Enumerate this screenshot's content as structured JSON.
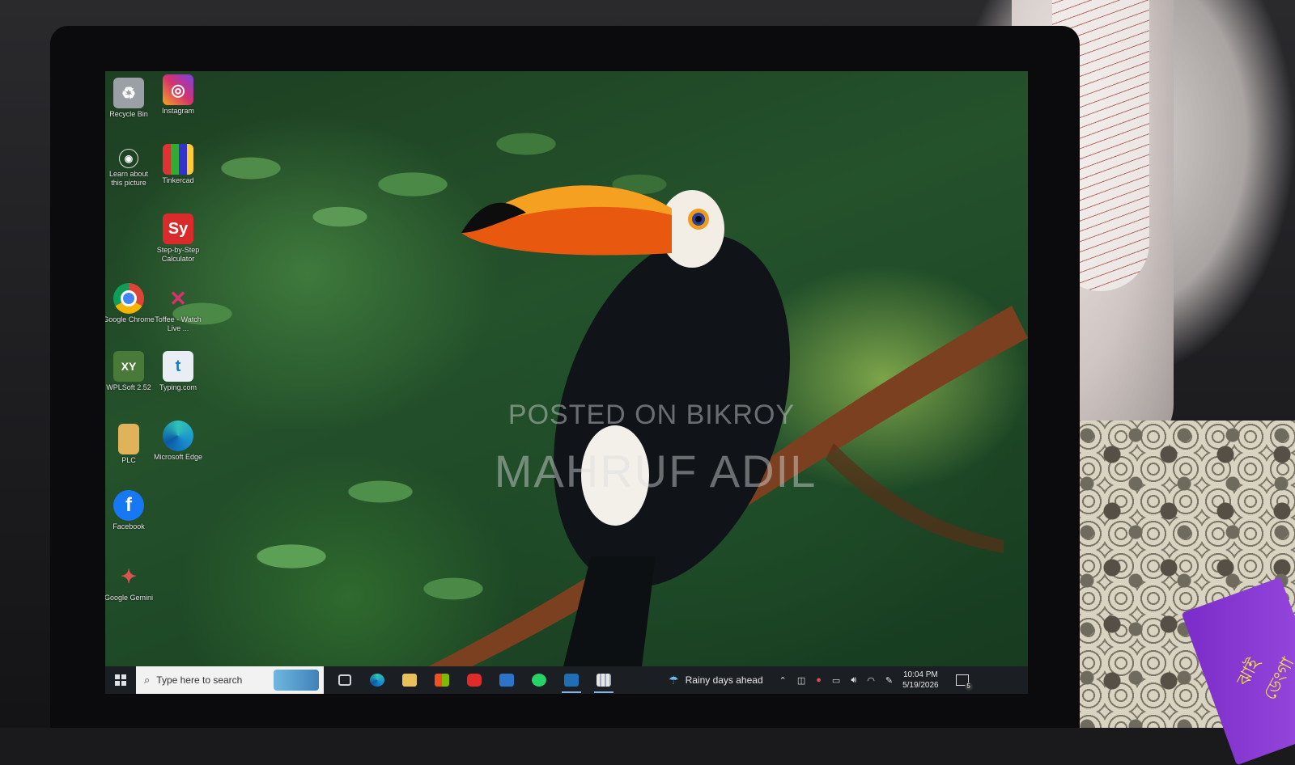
{
  "desktop_icons": [
    {
      "name": "recycle-bin",
      "label": "Recycle Bin",
      "icon": "recycle-bin-icon",
      "color": "#9aa0a6"
    },
    {
      "name": "instagram",
      "label": "Instagram",
      "icon": "instagram-icon",
      "color": "#d6336c"
    },
    {
      "name": "learn-about-picture",
      "label": "Learn about this picture",
      "icon": "camera-icon",
      "color": "#3b3b3b"
    },
    {
      "name": "tinkercad",
      "label": "Tinkercad",
      "icon": "tinkercad-icon",
      "color": "#e8e8e8"
    },
    {
      "name": "step-by-step-calculator",
      "label": "Step-by-Step Calculator",
      "icon": "calculator-icon",
      "glyph": "Sy",
      "color": "#d92b2b"
    },
    {
      "name": "google-chrome",
      "label": "Google Chrome",
      "icon": "chrome-icon",
      "color": "#1f8f3a"
    },
    {
      "name": "toffee",
      "label": "Toffee - Watch Live ...",
      "icon": "toffee-icon",
      "color": "#c0306a"
    },
    {
      "name": "wplsoft",
      "label": "WPLSoft 2.52",
      "icon": "wplsoft-icon",
      "glyph": "XY",
      "color": "#4a7a3a"
    },
    {
      "name": "typing-com",
      "label": "Typing.com",
      "icon": "typing-icon",
      "glyph": "t",
      "color": "#e8eef4"
    },
    {
      "name": "plc",
      "label": "PLC",
      "icon": "folder-icon",
      "color": "#e0b25a"
    },
    {
      "name": "microsoft-edge",
      "label": "Microsoft Edge",
      "icon": "edge-icon",
      "color": "#1a8fcf"
    },
    {
      "name": "facebook",
      "label": "Facebook",
      "icon": "facebook-icon",
      "glyph": "f",
      "color": "#1877f2"
    },
    {
      "name": "google-gemini",
      "label": "Google Gemini",
      "icon": "gemini-icon",
      "color": "#d9534f"
    }
  ],
  "watermark": {
    "line1": "POSTED ON BIKROY",
    "line2": "MAHRUF ADIL"
  },
  "taskbar": {
    "search_placeholder": "Type here to search",
    "apps": [
      {
        "name": "task-view",
        "icon": "task-view-icon",
        "color": "#cfd3d8"
      },
      {
        "name": "edge",
        "icon": "edge-icon",
        "color": "#1a8fcf"
      },
      {
        "name": "file-explorer",
        "icon": "folder-icon",
        "color": "#e8c15a"
      },
      {
        "name": "microsoft-store",
        "icon": "store-icon",
        "color": "#f0f0f0"
      },
      {
        "name": "youtube",
        "icon": "youtube-icon",
        "color": "#e02b2b"
      },
      {
        "name": "outlook",
        "icon": "mail-icon",
        "color": "#2c74c9"
      },
      {
        "name": "whatsapp",
        "icon": "whatsapp-icon",
        "color": "#25d366"
      },
      {
        "name": "app-active",
        "icon": "window-icon",
        "color": "#1f6fb5"
      },
      {
        "name": "app-grid",
        "icon": "grid-icon",
        "color": "#e6e6e6"
      }
    ],
    "weather": "Rainy days ahead",
    "time": "10:04 PM",
    "date": "5/19/2026",
    "notification_count": "5"
  },
  "book_title": "ঝাই ডেংগা"
}
